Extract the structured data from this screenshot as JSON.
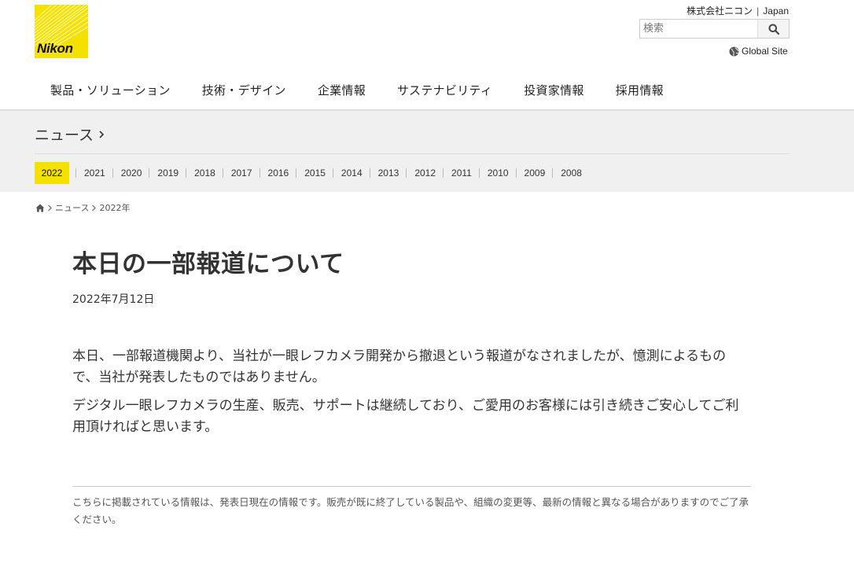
{
  "header": {
    "logo_text": "Nikon",
    "company_link": "株式会社ニコン",
    "region_link": "Japan",
    "search_placeholder": "検索",
    "global_site": "Global Site"
  },
  "nav": {
    "items": [
      {
        "label": "製品・ソリューション"
      },
      {
        "label": "技術・デザイン"
      },
      {
        "label": "企業情報"
      },
      {
        "label": "サステナビリティ"
      },
      {
        "label": "投資家情報"
      },
      {
        "label": "採用情報"
      }
    ]
  },
  "section": {
    "title": "ニュース",
    "years": [
      "2022",
      "2021",
      "2020",
      "2019",
      "2018",
      "2017",
      "2016",
      "2015",
      "2014",
      "2013",
      "2012",
      "2011",
      "2010",
      "2009",
      "2008"
    ],
    "active_year": "2022"
  },
  "breadcrumb": {
    "items": [
      "ニュース",
      "2022年"
    ]
  },
  "article": {
    "title": "本日の一部報道について",
    "date": "2022年7月12日",
    "paragraphs": [
      "本日、一部報道機関より、当社が一眼レフカメラ開発から撤退という報道がなされましたが、憶測によるもので、当社が発表したものではありません。",
      "デジタル一眼レフカメラの生産、販売、サポートは継続しており、ご愛用のお客様には引き続きご安心してご利用頂ければと思います。"
    ],
    "note": "こちらに掲載されている情報は、発表日現在の情報です。販売が既に終了している製品や、組織の変更等、最新の情報と異なる場合がありますのでご了承ください。"
  },
  "colors": {
    "brand_yellow": "#f5e100",
    "band_gray": "#f0f0f0",
    "text": "#333333"
  }
}
